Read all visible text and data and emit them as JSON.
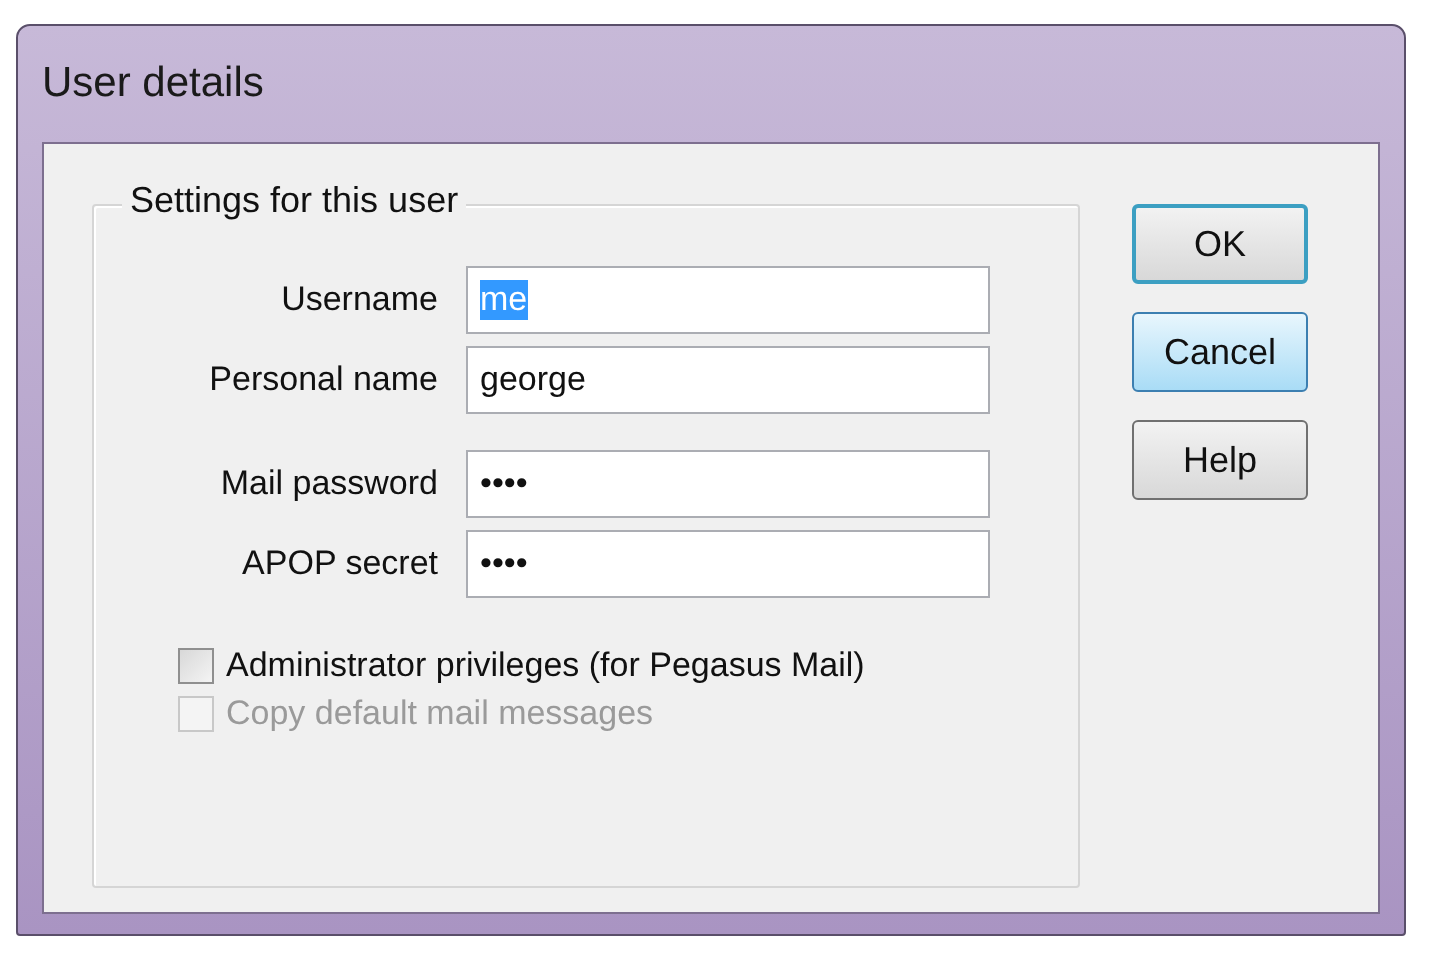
{
  "window": {
    "title": "User details"
  },
  "group": {
    "title": "Settings for this user"
  },
  "field_sections": [
    {
      "fields": [
        {
          "label": "Username",
          "value": "me",
          "text_selected": true
        },
        {
          "label": "Personal name",
          "value": "george",
          "text_selected": false
        }
      ]
    },
    {
      "fields": [
        {
          "label": "Mail password",
          "value": "••••",
          "text_selected": false
        },
        {
          "label": "APOP secret",
          "value": "••••",
          "text_selected": false
        }
      ]
    }
  ],
  "checkboxes": [
    {
      "label": "Administrator privileges (for Pegasus Mail)",
      "checked": false,
      "disabled": false
    },
    {
      "label": "Copy default mail messages",
      "checked": false,
      "disabled": true
    }
  ],
  "buttons": [
    {
      "label": "OK",
      "default": true,
      "hot": false
    },
    {
      "label": "Cancel",
      "default": false,
      "hot": true
    },
    {
      "label": "Help",
      "default": false,
      "hot": false
    }
  ]
}
